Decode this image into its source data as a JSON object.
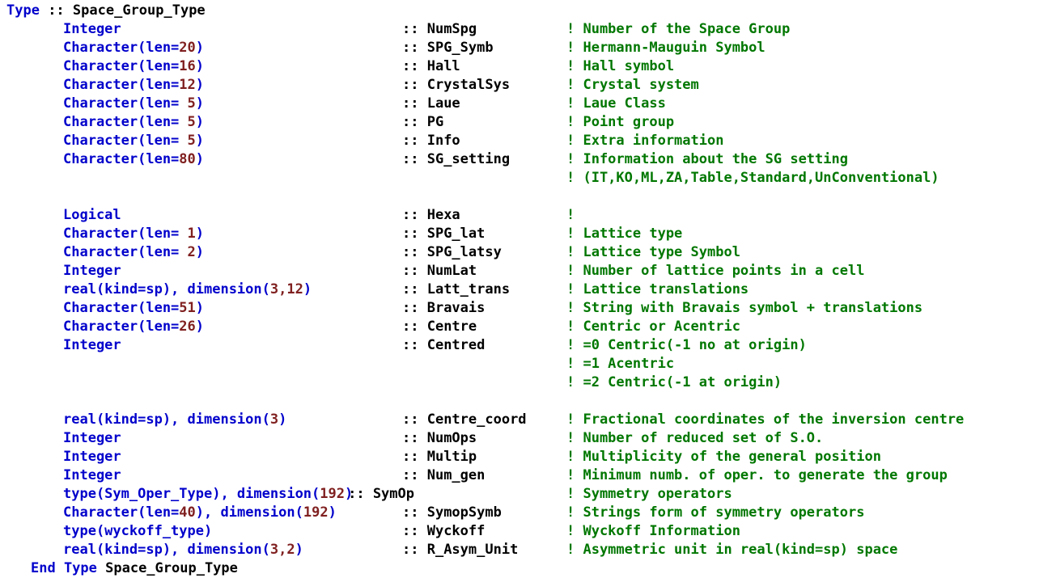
{
  "document": {
    "language": "Fortran",
    "title": "Space_Group_Type",
    "colors": {
      "background": "#ffffff",
      "keyword": "#0000CC",
      "number": "#802020",
      "identifier": "#000000",
      "comment": "#007700"
    }
  },
  "header": {
    "keyword": "Type",
    "separator": " :: ",
    "name": "Space_Group_Type"
  },
  "footer": {
    "keyword": "End Type",
    "name": " Space_Group_Type"
  },
  "lines": [
    {
      "kind": "header",
      "indent": 2,
      "segments": [
        {
          "text": "Type",
          "cls": "tok-kw"
        },
        {
          "text": " :: ",
          "cls": "tok-punc"
        },
        {
          "text": "Space_Group_Type",
          "cls": "tok-id"
        }
      ]
    },
    {
      "kind": "field",
      "type_segments": [
        {
          "text": "Integer",
          "cls": "tok-kw"
        }
      ],
      "sep": ":: ",
      "name": "NumSpg",
      "comment": "! Number of the Space Group"
    },
    {
      "kind": "field",
      "type_segments": [
        {
          "text": "Character(len=",
          "cls": "tok-kw"
        },
        {
          "text": "20",
          "cls": "tok-num"
        },
        {
          "text": ")",
          "cls": "tok-kw"
        }
      ],
      "sep": ":: ",
      "name": "SPG_Symb",
      "comment": "! Hermann-Mauguin Symbol"
    },
    {
      "kind": "field",
      "type_segments": [
        {
          "text": "Character(len=",
          "cls": "tok-kw"
        },
        {
          "text": "16",
          "cls": "tok-num"
        },
        {
          "text": ")",
          "cls": "tok-kw"
        }
      ],
      "sep": ":: ",
      "name": "Hall",
      "comment": "! Hall symbol"
    },
    {
      "kind": "field",
      "type_segments": [
        {
          "text": "Character(len=",
          "cls": "tok-kw"
        },
        {
          "text": "12",
          "cls": "tok-num"
        },
        {
          "text": ")",
          "cls": "tok-kw"
        }
      ],
      "sep": ":: ",
      "name": "CrystalSys",
      "comment": "! Crystal system"
    },
    {
      "kind": "field",
      "type_segments": [
        {
          "text": "Character(len= ",
          "cls": "tok-kw"
        },
        {
          "text": "5",
          "cls": "tok-num"
        },
        {
          "text": ")",
          "cls": "tok-kw"
        }
      ],
      "sep": ":: ",
      "name": "Laue",
      "comment": "! Laue Class"
    },
    {
      "kind": "field",
      "type_segments": [
        {
          "text": "Character(len= ",
          "cls": "tok-kw"
        },
        {
          "text": "5",
          "cls": "tok-num"
        },
        {
          "text": ")",
          "cls": "tok-kw"
        }
      ],
      "sep": ":: ",
      "name": "PG",
      "comment": "! Point group"
    },
    {
      "kind": "field",
      "type_segments": [
        {
          "text": "Character(len= ",
          "cls": "tok-kw"
        },
        {
          "text": "5",
          "cls": "tok-num"
        },
        {
          "text": ")",
          "cls": "tok-kw"
        }
      ],
      "sep": ":: ",
      "name": "Info",
      "comment": "! Extra information"
    },
    {
      "kind": "field",
      "type_segments": [
        {
          "text": "Character(len=",
          "cls": "tok-kw"
        },
        {
          "text": "80",
          "cls": "tok-num"
        },
        {
          "text": ")",
          "cls": "tok-kw"
        }
      ],
      "sep": ":: ",
      "name": "SG_setting",
      "comment": "! Information about the SG setting"
    },
    {
      "kind": "comment-only",
      "comment": "! (IT,KO,ML,ZA,Table,Standard,UnConventional)"
    },
    {
      "kind": "blank"
    },
    {
      "kind": "field",
      "type_segments": [
        {
          "text": "Logical",
          "cls": "tok-kw"
        }
      ],
      "sep": ":: ",
      "name": "Hexa",
      "comment": "!"
    },
    {
      "kind": "field",
      "type_segments": [
        {
          "text": "Character(len= ",
          "cls": "tok-kw"
        },
        {
          "text": "1",
          "cls": "tok-num"
        },
        {
          "text": ")",
          "cls": "tok-kw"
        }
      ],
      "sep": ":: ",
      "name": "SPG_lat",
      "comment": "! Lattice type"
    },
    {
      "kind": "field",
      "type_segments": [
        {
          "text": "Character(len= ",
          "cls": "tok-kw"
        },
        {
          "text": "2",
          "cls": "tok-num"
        },
        {
          "text": ")",
          "cls": "tok-kw"
        }
      ],
      "sep": ":: ",
      "name": "SPG_latsy",
      "comment": "! Lattice type Symbol"
    },
    {
      "kind": "field",
      "type_segments": [
        {
          "text": "Integer",
          "cls": "tok-kw"
        }
      ],
      "sep": ":: ",
      "name": "NumLat",
      "comment": "! Number of lattice points in a cell"
    },
    {
      "kind": "field",
      "type_segments": [
        {
          "text": "real(kind=sp), dimension(",
          "cls": "tok-kw"
        },
        {
          "text": "3",
          "cls": "tok-num"
        },
        {
          "text": ",",
          "cls": "tok-num"
        },
        {
          "text": "12",
          "cls": "tok-num"
        },
        {
          "text": ")",
          "cls": "tok-kw"
        }
      ],
      "sep": ":: ",
      "name": "Latt_trans",
      "comment": "! Lattice translations"
    },
    {
      "kind": "field",
      "type_segments": [
        {
          "text": "Character(len=",
          "cls": "tok-kw"
        },
        {
          "text": "51",
          "cls": "tok-num"
        },
        {
          "text": ")",
          "cls": "tok-kw"
        }
      ],
      "sep": ":: ",
      "name": "Bravais",
      "comment": "! String with Bravais symbol + translations"
    },
    {
      "kind": "field",
      "type_segments": [
        {
          "text": "Character(len=",
          "cls": "tok-kw"
        },
        {
          "text": "26",
          "cls": "tok-num"
        },
        {
          "text": ")",
          "cls": "tok-kw"
        }
      ],
      "sep": ":: ",
      "name": "Centre",
      "comment": "! Centric or Acentric"
    },
    {
      "kind": "field",
      "type_segments": [
        {
          "text": "Integer",
          "cls": "tok-kw"
        }
      ],
      "sep": ":: ",
      "name": "Centred",
      "comment": "! =0 Centric(-1 no at origin)"
    },
    {
      "kind": "comment-only",
      "comment": "! =1 Acentric"
    },
    {
      "kind": "comment-only",
      "comment": "! =2 Centric(-1 at origin)"
    },
    {
      "kind": "blank"
    },
    {
      "kind": "field",
      "type_segments": [
        {
          "text": "real(kind=sp), dimension(",
          "cls": "tok-kw"
        },
        {
          "text": "3",
          "cls": "tok-num"
        },
        {
          "text": ")",
          "cls": "tok-kw"
        }
      ],
      "sep": ":: ",
      "name": "Centre_coord",
      "comment": "! Fractional coordinates of the inversion centre"
    },
    {
      "kind": "field",
      "type_segments": [
        {
          "text": "Integer",
          "cls": "tok-kw"
        }
      ],
      "sep": ":: ",
      "name": "NumOps",
      "comment": "! Number of reduced set of S.O."
    },
    {
      "kind": "field",
      "type_segments": [
        {
          "text": "Integer",
          "cls": "tok-kw"
        }
      ],
      "sep": ":: ",
      "name": "Multip",
      "comment": "! Multiplicity of the general position"
    },
    {
      "kind": "field",
      "type_segments": [
        {
          "text": "Integer",
          "cls": "tok-kw"
        }
      ],
      "sep": ":: ",
      "name": "Num_gen",
      "comment": "! Minimum numb. of oper. to generate the group"
    },
    {
      "kind": "field-tight",
      "type_segments": [
        {
          "text": "type(Sym_Oper_Type), dimension(",
          "cls": "tok-kw"
        },
        {
          "text": "192",
          "cls": "tok-num"
        },
        {
          "text": ")",
          "cls": "tok-kw"
        }
      ],
      "sep": ":: ",
      "name": "SymOp",
      "comment": "! Symmetry operators"
    },
    {
      "kind": "field",
      "type_segments": [
        {
          "text": "Character(len=",
          "cls": "tok-kw"
        },
        {
          "text": "40",
          "cls": "tok-num"
        },
        {
          "text": "), dimension(",
          "cls": "tok-kw"
        },
        {
          "text": "192",
          "cls": "tok-num"
        },
        {
          "text": ")",
          "cls": "tok-kw"
        }
      ],
      "sep": ":: ",
      "name": "SymopSymb",
      "comment": "! Strings form of symmetry operators"
    },
    {
      "kind": "field",
      "type_segments": [
        {
          "text": "type(wyckoff_type)",
          "cls": "tok-kw"
        }
      ],
      "sep": ":: ",
      "name": "Wyckoff",
      "comment": "! Wyckoff Information"
    },
    {
      "kind": "field",
      "type_segments": [
        {
          "text": "real(kind=sp), dimension(",
          "cls": "tok-kw"
        },
        {
          "text": "3",
          "cls": "tok-num"
        },
        {
          "text": ",",
          "cls": "tok-num"
        },
        {
          "text": "2",
          "cls": "tok-num"
        },
        {
          "text": ")",
          "cls": "tok-kw"
        }
      ],
      "sep": ":: ",
      "name": "R_Asym_Unit",
      "comment": "! Asymmetric unit in real(kind=sp) space"
    },
    {
      "kind": "footer",
      "segments": [
        {
          "text": "End Type",
          "cls": "tok-kw"
        },
        {
          "text": " Space_Group_Type",
          "cls": "tok-id"
        }
      ]
    }
  ]
}
